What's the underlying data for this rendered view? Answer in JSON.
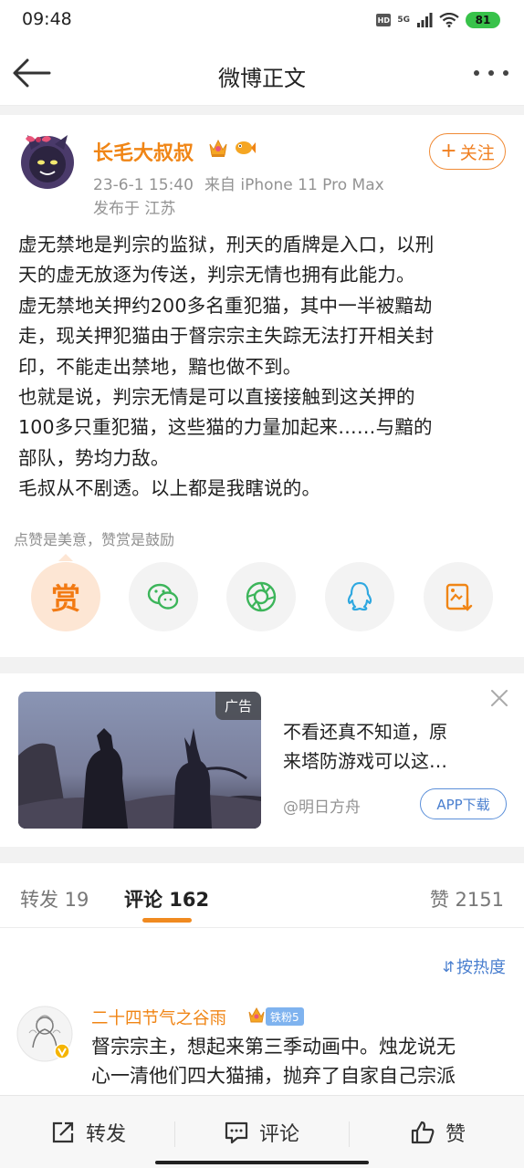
{
  "status_bar": {
    "time": "09:48",
    "hd": "HD",
    "signal": "5G",
    "battery": "81"
  },
  "nav": {
    "title": "微博正文"
  },
  "post": {
    "author": "长毛大叔叔",
    "meta": {
      "date": "23-6-1 15:40",
      "source": "来自 iPhone 11 Pro Max"
    },
    "location": "发布于 江苏",
    "follow_label": "关注",
    "lines": [
      "虚无禁地是判宗的监狱，刑天的盾牌是入口，以刑",
      "天的虚无放逐为传送，判宗无情也拥有此能力。",
      "虚无禁地关押约200多名重犯猫，其中一半被黯劫",
      "走，现关押犯猫由于督宗宗主失踪无法打开相关封",
      "印，不能走出禁地，黯也做不到。",
      "也就是说，判宗无情是可以直接接触到这关押的",
      "100多只重犯猫，这些猫的力量加起来……与黯的",
      "部队，势均力敌。",
      "毛叔从不剧透。以上都是我瞎说的。"
    ],
    "reward_hint": "点赞是美意，赞赏是鼓励",
    "reward_label": "赏"
  },
  "share_icons": [
    "wechat-icon",
    "moments-icon",
    "qq-icon",
    "save-image-icon"
  ],
  "ad": {
    "label": "广告",
    "title_lines": [
      "不看还真不知道，原",
      "来塔防游戏可以这…"
    ],
    "source": "@明日方舟",
    "download": "APP下载"
  },
  "tabs": {
    "repost": "转发 19",
    "comments": "评论 162",
    "likes": "赞 2151"
  },
  "sort": {
    "icon": "⇵",
    "label": "按热度"
  },
  "comment": {
    "name": "二十四节气之谷雨",
    "fan_badge": "铁粉5",
    "lines": [
      "督宗宗主，想起来第三季动画中。烛龙说无",
      "心一清他们四大猫捕，抛弃了自家自己宗派"
    ]
  },
  "bottom_bar": {
    "repost": "转发",
    "comment": "评论",
    "like": "赞"
  },
  "colors": {
    "accent": "#f08515",
    "link": "#4a7fcf",
    "fan_badge": "#7fb3ef"
  }
}
